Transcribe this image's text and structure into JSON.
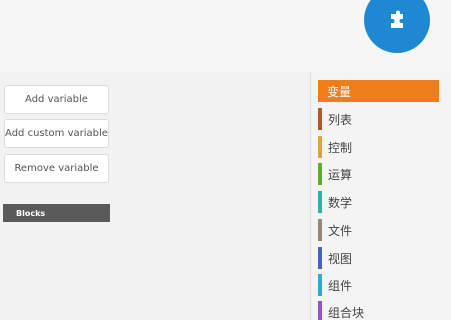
{
  "workspace": {
    "buttons": [
      {
        "label": "Add variable"
      },
      {
        "label": "Add custom variable"
      },
      {
        "label": "Remove variable"
      }
    ],
    "blocks_label": "Blocks"
  },
  "fab": {
    "icon": "puzzle-piece-icon",
    "color": "#1e88d2"
  },
  "categories": [
    {
      "label": "变量",
      "color": "#ef7e1a",
      "selected": true
    },
    {
      "label": "列表",
      "color": "#b5582a"
    },
    {
      "label": "控制",
      "color": "#e0a634"
    },
    {
      "label": "运算",
      "color": "#5db02c"
    },
    {
      "label": "数学",
      "color": "#2ab3a6"
    },
    {
      "label": "文件",
      "color": "#9a8578"
    },
    {
      "label": "视图",
      "color": "#4a5fc2"
    },
    {
      "label": "组件",
      "color": "#2fa9d6"
    },
    {
      "label": "组合块",
      "color": "#9256c4"
    }
  ]
}
